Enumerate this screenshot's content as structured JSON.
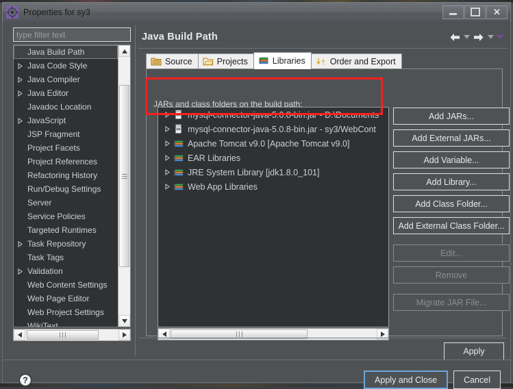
{
  "window": {
    "title": "Properties for sy3",
    "icon": "gear-icon",
    "minimize_label": "Minimize",
    "maximize_label": "Maximize",
    "close_label": "Close"
  },
  "sidebar": {
    "filter_placeholder": "type filter text",
    "filter_value": "",
    "items": [
      {
        "label": "Java Build Path",
        "expandable": false,
        "selected": true
      },
      {
        "label": "Java Code Style",
        "expandable": true,
        "selected": false
      },
      {
        "label": "Java Compiler",
        "expandable": true,
        "selected": false
      },
      {
        "label": "Java Editor",
        "expandable": true,
        "selected": false
      },
      {
        "label": "Javadoc Location",
        "expandable": false,
        "selected": false
      },
      {
        "label": "JavaScript",
        "expandable": true,
        "selected": false
      },
      {
        "label": "JSP Fragment",
        "expandable": false,
        "selected": false
      },
      {
        "label": "Project Facets",
        "expandable": false,
        "selected": false
      },
      {
        "label": "Project References",
        "expandable": false,
        "selected": false
      },
      {
        "label": "Refactoring History",
        "expandable": false,
        "selected": false
      },
      {
        "label": "Run/Debug Settings",
        "expandable": false,
        "selected": false
      },
      {
        "label": "Server",
        "expandable": false,
        "selected": false
      },
      {
        "label": "Service Policies",
        "expandable": false,
        "selected": false
      },
      {
        "label": "Targeted Runtimes",
        "expandable": false,
        "selected": false
      },
      {
        "label": "Task Repository",
        "expandable": true,
        "selected": false
      },
      {
        "label": "Task Tags",
        "expandable": false,
        "selected": false
      },
      {
        "label": "Validation",
        "expandable": true,
        "selected": false
      },
      {
        "label": "Web Content Settings",
        "expandable": false,
        "selected": false
      },
      {
        "label": "Web Page Editor",
        "expandable": false,
        "selected": false
      },
      {
        "label": "Web Project Settings",
        "expandable": false,
        "selected": false
      },
      {
        "label": "WikiText",
        "expandable": false,
        "selected": false
      }
    ]
  },
  "page": {
    "title": "Java Build Path",
    "nav": {
      "back_icon": "arrow-left-icon",
      "back_menu_icon": "chevron-down-icon",
      "forward_icon": "arrow-right-icon",
      "forward_menu_icon": "chevron-down-icon",
      "view_menu_icon": "chevron-down-icon"
    }
  },
  "tabs": [
    {
      "label": "Source",
      "icon": "source-folder-icon",
      "active": false
    },
    {
      "label": "Projects",
      "icon": "projects-folder-icon",
      "active": false
    },
    {
      "label": "Libraries",
      "icon": "library-books-icon",
      "active": true
    },
    {
      "label": "Order and Export",
      "icon": "order-arrows-icon",
      "active": false
    }
  ],
  "libraries_tab": {
    "list_label": "JARs and class folders on the build path:",
    "entries": [
      {
        "label": "mysql-connector-java-5.0.8-bin.jar - D:\\Documents",
        "icon": "jar-icon",
        "expandable": true,
        "highlighted": true
      },
      {
        "label": "mysql-connector-java-5.0.8-bin.jar - sy3/WebCont",
        "icon": "jar-icon",
        "expandable": true,
        "highlighted": true
      },
      {
        "label": "Apache Tomcat v9.0 [Apache Tomcat v9.0]",
        "icon": "library-icon",
        "expandable": true,
        "highlighted": false
      },
      {
        "label": "EAR Libraries",
        "icon": "library-icon",
        "expandable": true,
        "highlighted": false
      },
      {
        "label": "JRE System Library [jdk1.8.0_101]",
        "icon": "library-icon",
        "expandable": true,
        "highlighted": false
      },
      {
        "label": "Web App Libraries",
        "icon": "library-icon",
        "expandable": true,
        "highlighted": false
      }
    ],
    "buttons": [
      {
        "label": "Add JARs...",
        "mnemonic": "J",
        "enabled": true,
        "group": 1
      },
      {
        "label": "Add External JARs...",
        "mnemonic": "x",
        "enabled": true,
        "group": 1
      },
      {
        "label": "Add Variable...",
        "mnemonic": "V",
        "enabled": true,
        "group": 1
      },
      {
        "label": "Add Library...",
        "mnemonic": "i",
        "enabled": true,
        "group": 1
      },
      {
        "label": "Add Class Folder...",
        "mnemonic": "C",
        "enabled": true,
        "group": 1
      },
      {
        "label": "Add External Class Folder...",
        "mnemonic": "d",
        "enabled": true,
        "group": 1
      },
      {
        "label": "Edit...",
        "mnemonic": "",
        "enabled": false,
        "group": 2
      },
      {
        "label": "Remove",
        "mnemonic": "",
        "enabled": false,
        "group": 2
      },
      {
        "label": "Migrate JAR File...",
        "mnemonic": "",
        "enabled": false,
        "group": 3
      }
    ]
  },
  "apply": {
    "label": "Apply"
  },
  "footer": {
    "help_icon": "help-question-icon",
    "apply_and_close": "Apply and Close",
    "cancel": "Cancel"
  },
  "annotation": {
    "type": "red-rectangle-highlight",
    "target": "first two mysql-connector jar entries"
  },
  "colors": {
    "dialog_bg": "#4e5254",
    "list_bg": "#2f3234",
    "text": "#d7d7d7",
    "annotation_red": "#fb1f1f",
    "default_button_border": "#6ea6d8",
    "tab_active_bg": "#ffffff"
  }
}
